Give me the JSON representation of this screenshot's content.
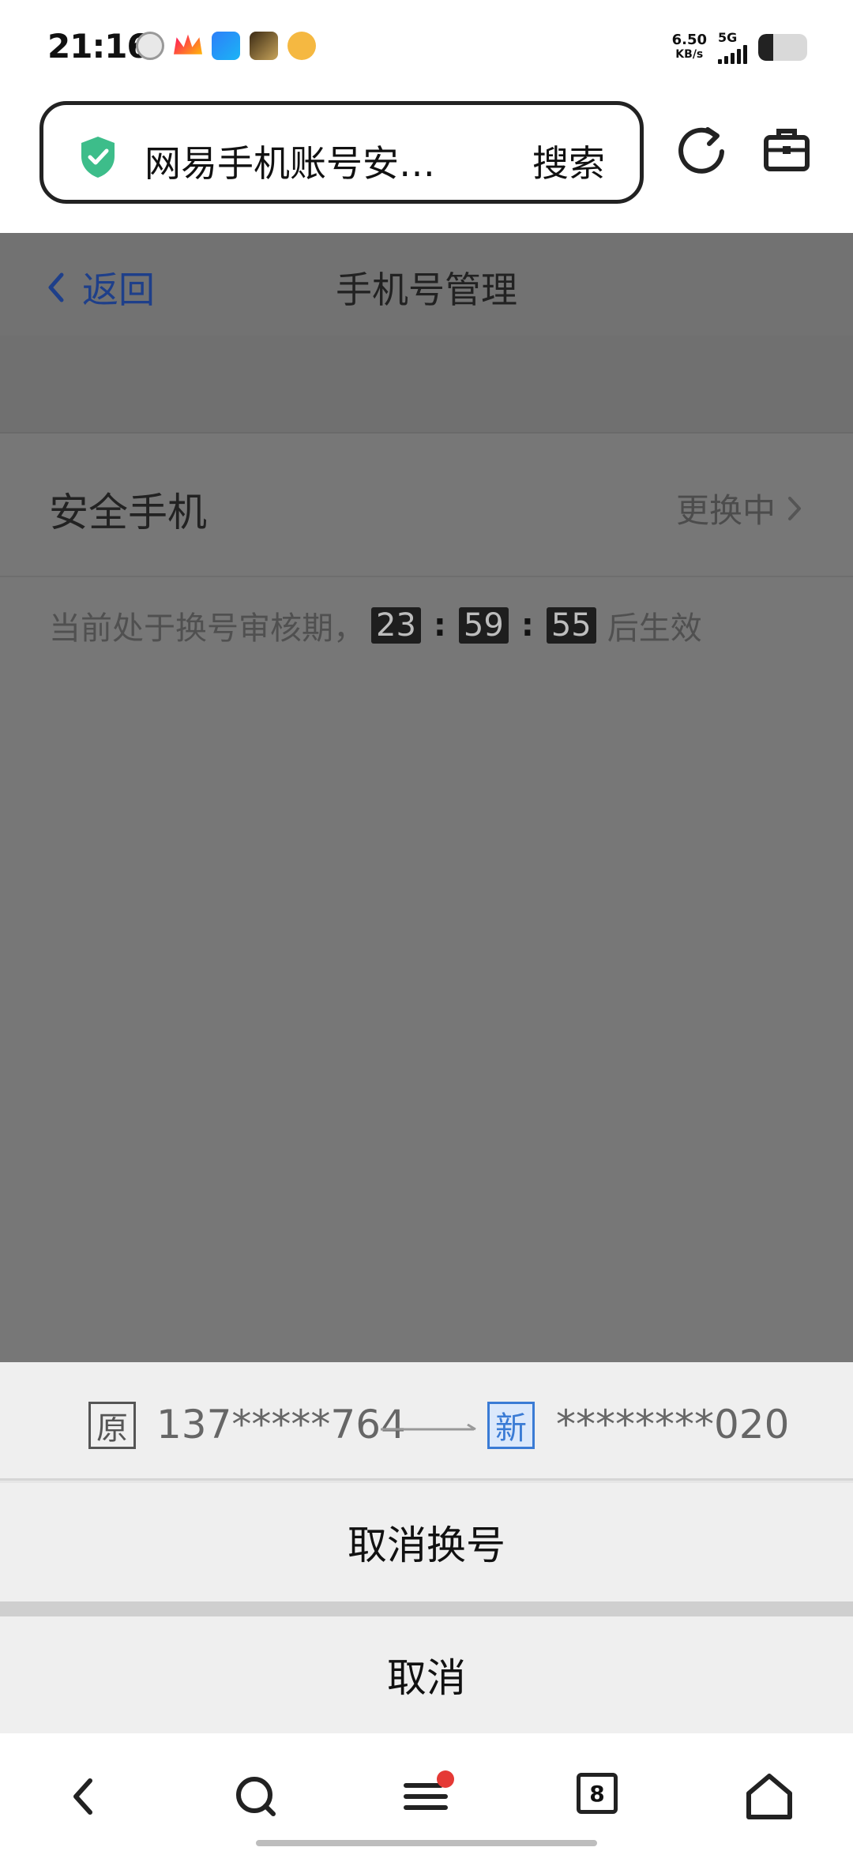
{
  "status_bar": {
    "time": "21:16",
    "net_speed_value": "6.50",
    "net_speed_unit": "KB/s",
    "network_type": "5G",
    "battery_level": 0.3,
    "notification_icons": [
      "settings-app-icon",
      "crown-app-icon",
      "browser-app-icon",
      "game-app-icon",
      "music-app-icon"
    ]
  },
  "browser": {
    "url_text": "网易手机账号安…",
    "search_label": "搜索",
    "tab_count": "8"
  },
  "page": {
    "back_label": "返回",
    "title": "手机号管理",
    "row_label": "安全手机",
    "row_status": "更换中",
    "notice_prefix": "当前处于换号审核期，",
    "countdown": {
      "hours": "23",
      "minutes": "59",
      "seconds": "55"
    },
    "colon": ":",
    "notice_suffix": "后生效"
  },
  "sheet": {
    "old_badge": "原",
    "old_number": "137*****764",
    "new_badge": "新",
    "new_number": "********020",
    "cancel_swap_label": "取消换号",
    "cancel_label": "取消"
  },
  "colors": {
    "accent_blue": "#3a7bd5",
    "shield_green": "#3dbd8a",
    "dim_overlay": "#777777",
    "notification_dot": "#e53935"
  }
}
